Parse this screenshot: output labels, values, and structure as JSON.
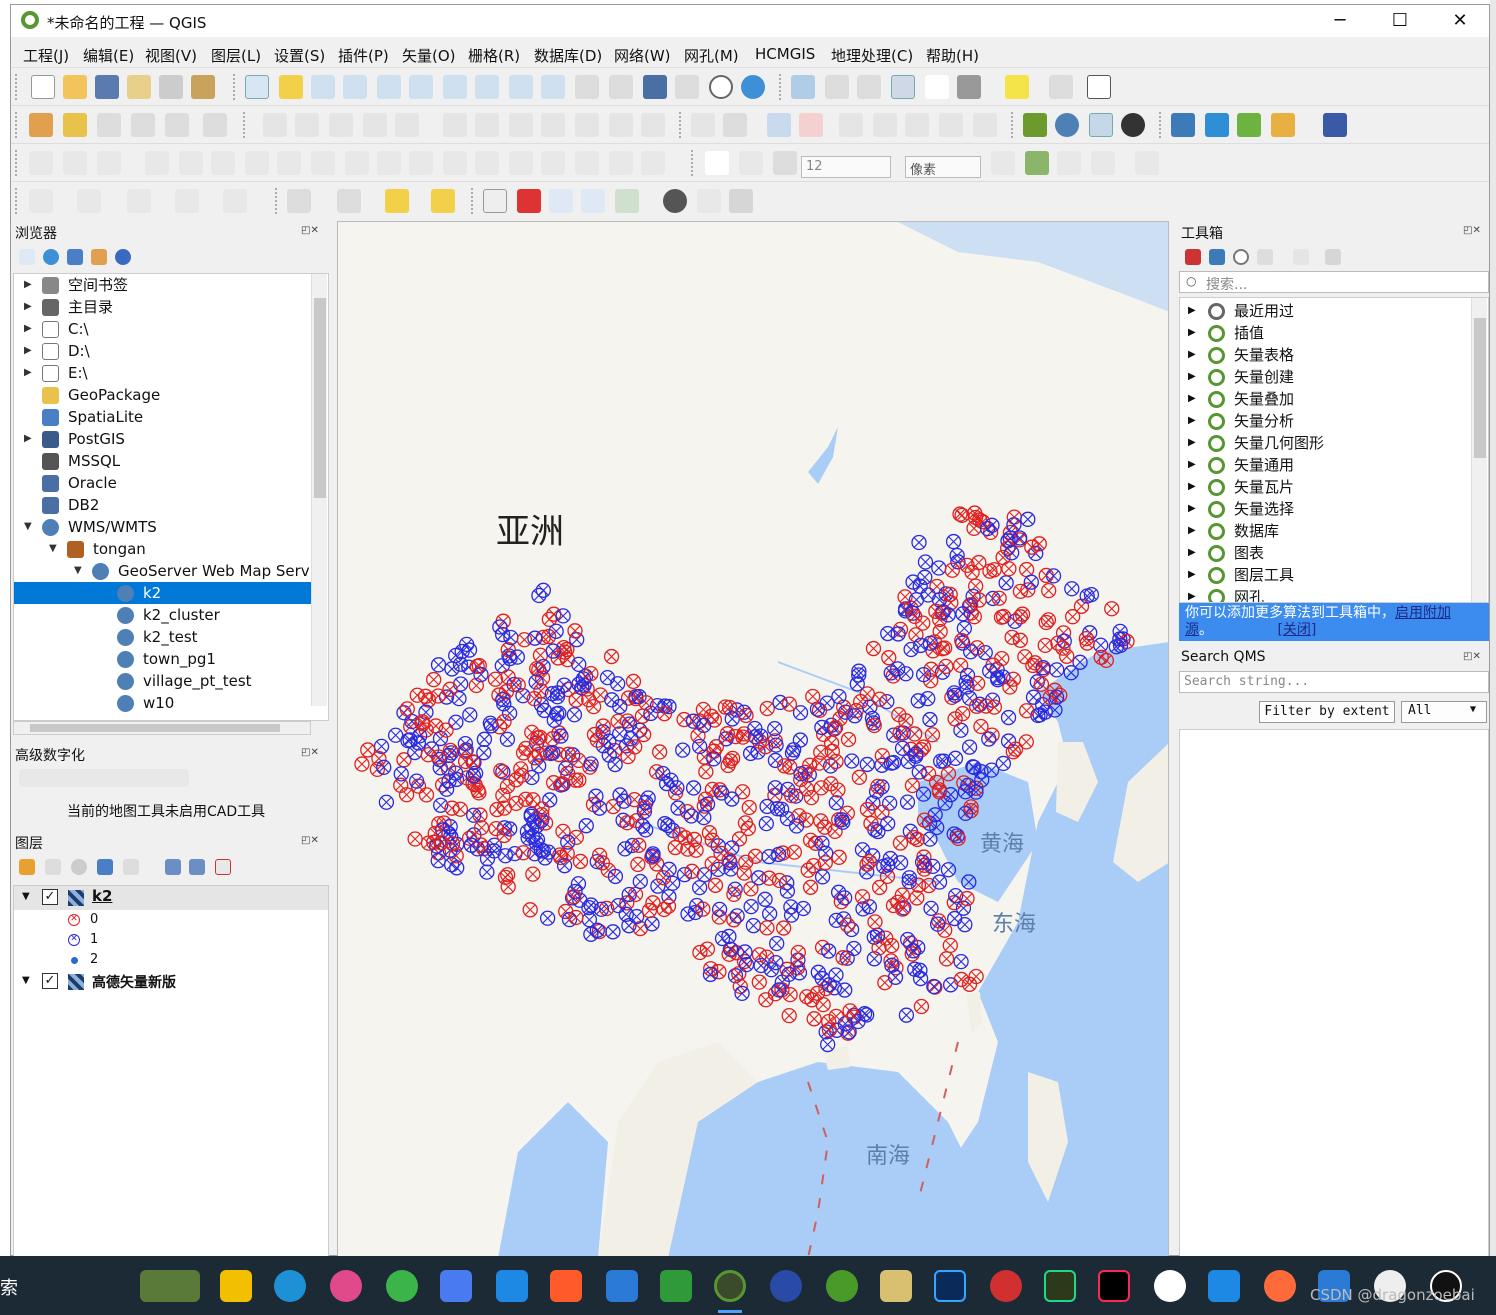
{
  "window": {
    "title": "*未命名的工程 — QGIS",
    "minimize": "─",
    "maximize": "☐",
    "close": "✕"
  },
  "menu": [
    "工程(J)",
    "编辑(E)",
    "视图(V)",
    "图层(L)",
    "设置(S)",
    "插件(P)",
    "矢量(O)",
    "栅格(R)",
    "数据库(D)",
    "网络(W)",
    "网孔(M)",
    "HCMGIS",
    "地理处理(C)",
    "帮助(H)"
  ],
  "toolbar": {
    "font_size_value": "12",
    "unit_select": "像素"
  },
  "browser": {
    "title": "浏览器",
    "items": [
      {
        "label": "空间书签",
        "icon": "bookmark-icon",
        "expandable": true,
        "indent": 0
      },
      {
        "label": "主目录",
        "icon": "home-icon",
        "expandable": true,
        "indent": 0
      },
      {
        "label": "C:\\",
        "icon": "folder-icon",
        "expandable": true,
        "indent": 0
      },
      {
        "label": "D:\\",
        "icon": "folder-icon",
        "expandable": true,
        "indent": 0
      },
      {
        "label": "E:\\",
        "icon": "folder-icon",
        "expandable": true,
        "indent": 0
      },
      {
        "label": "GeoPackage",
        "icon": "geopackage-icon",
        "expandable": false,
        "indent": 0
      },
      {
        "label": "SpatiaLite",
        "icon": "spatialite-icon",
        "expandable": false,
        "indent": 0
      },
      {
        "label": "PostGIS",
        "icon": "postgis-icon",
        "expandable": true,
        "indent": 0
      },
      {
        "label": "MSSQL",
        "icon": "mssql-icon",
        "expandable": false,
        "indent": 0
      },
      {
        "label": "Oracle",
        "icon": "oracle-icon",
        "expandable": false,
        "indent": 0
      },
      {
        "label": "DB2",
        "icon": "db2-icon",
        "expandable": false,
        "indent": 0
      },
      {
        "label": "WMS/WMTS",
        "icon": "globe-icon",
        "expandable": true,
        "expanded": true,
        "indent": 0
      },
      {
        "label": "tongan",
        "icon": "connection-icon",
        "expandable": true,
        "expanded": true,
        "indent": 1
      },
      {
        "label": "GeoServer Web Map Servi",
        "icon": "globe-icon",
        "expandable": true,
        "expanded": true,
        "indent": 2
      },
      {
        "label": "k2",
        "icon": "globe-icon",
        "expandable": false,
        "indent": 3,
        "selected": true
      },
      {
        "label": "k2_cluster",
        "icon": "globe-icon",
        "expandable": false,
        "indent": 3
      },
      {
        "label": "k2_test",
        "icon": "globe-icon",
        "expandable": false,
        "indent": 3
      },
      {
        "label": "town_pg1",
        "icon": "globe-icon",
        "expandable": false,
        "indent": 3
      },
      {
        "label": "village_pt_test",
        "icon": "globe-icon",
        "expandable": false,
        "indent": 3
      },
      {
        "label": "w10",
        "icon": "globe-icon",
        "expandable": false,
        "indent": 3
      }
    ]
  },
  "advanced_digitizing": {
    "title": "高级数字化",
    "message": "当前的地图工具未启用CAD工具"
  },
  "layers": {
    "title": "图层",
    "items": [
      {
        "label": "k2",
        "checked": true,
        "bold": true,
        "legend": [
          {
            "label": "0",
            "symbol": "red-cross-circle"
          },
          {
            "label": "1",
            "symbol": "blue-cross-circle"
          },
          {
            "label": "2",
            "symbol": "blue-dot"
          }
        ]
      },
      {
        "label": "高德矢量新版",
        "checked": true,
        "bold": true
      }
    ]
  },
  "map": {
    "labels": {
      "asia": "亚洲",
      "yellow_sea": "黄海",
      "east_sea": "东海",
      "south_sea": "南海"
    },
    "colors": {
      "land": "#f6f4ee",
      "water": "#a9cdf7",
      "red": "#e02020",
      "blue": "#2a2ae0"
    }
  },
  "toolbox": {
    "title": "工具箱",
    "search_placeholder": "搜索...",
    "items": [
      "最近用过",
      "插值",
      "矢量表格",
      "矢量创建",
      "矢量叠加",
      "矢量分析",
      "矢量几何图形",
      "矢量通用",
      "矢量瓦片",
      "矢量选择",
      "数据库",
      "图表",
      "图层工具",
      "网孔"
    ],
    "notice": "你可以添加更多算法到工具箱中，",
    "notice_link": "启用附加",
    "notice_tail": "源",
    "notice_close": "[关闭]"
  },
  "qms": {
    "title": "Search QMS",
    "placeholder": "Search string...",
    "filter_button": "Filter by extent",
    "filter_select": "All"
  },
  "taskbar": {
    "search_char": "索",
    "watermark": "CSDN @dragonzoebai"
  }
}
